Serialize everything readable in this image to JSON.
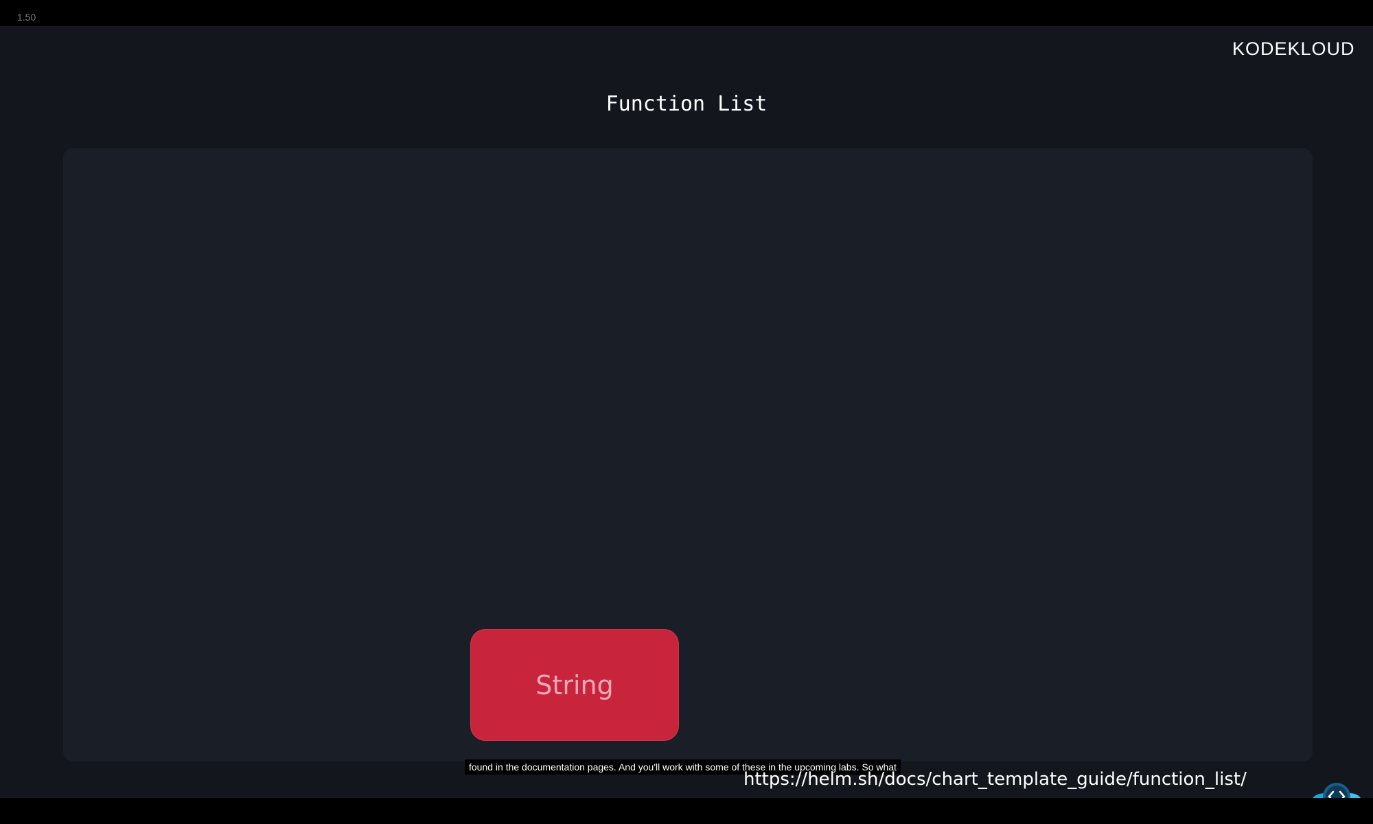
{
  "player": {
    "speed": "1.50"
  },
  "slide": {
    "logo_text": "KODEKLOUD",
    "title": "Function List",
    "string_label": "String",
    "url": "https://helm.sh/docs/chart_template_guide/function_list/"
  },
  "caption": {
    "text": "found in the documentation pages. And you'll work with some of these in the upcoming labs. So what"
  },
  "icons": {
    "corner_icon": "code-cloud-icon"
  },
  "colors": {
    "background": "#13171d",
    "panel": "#1a1e26",
    "string_button": "#c8253d",
    "string_text": "#f0a8b6"
  }
}
